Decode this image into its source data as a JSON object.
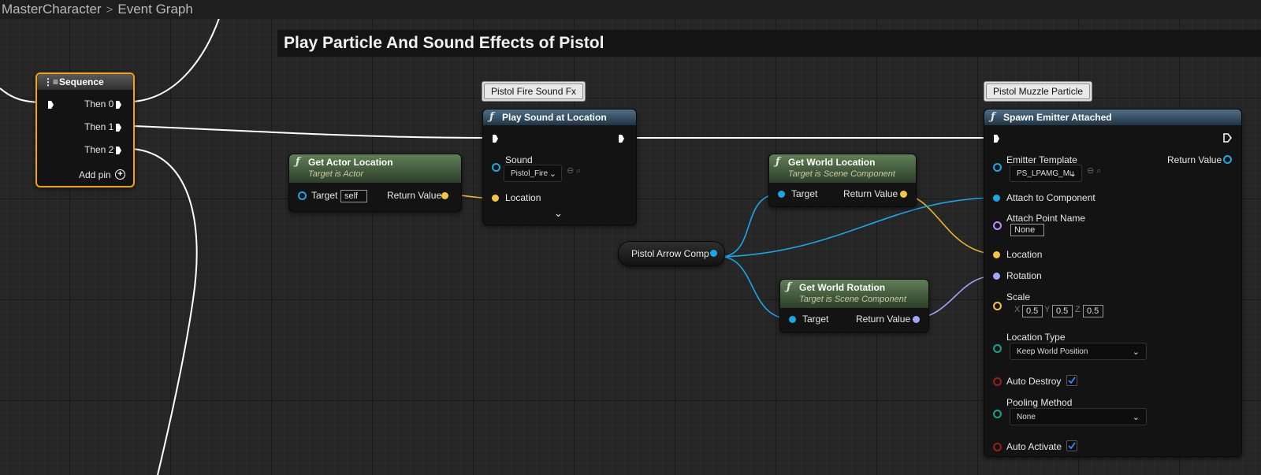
{
  "breadcrumb": {
    "parent": "MasterCharacter",
    "current": "Event Graph"
  },
  "comment": {
    "title": "Play Particle And Sound Effects of Pistol"
  },
  "tags": {
    "sound_fx": "Pistol Fire Sound Fx",
    "muzzle": "Pistol Muzzle Particle"
  },
  "sequence": {
    "title": "Sequence",
    "then0": "Then 0",
    "then1": "Then 1",
    "then2": "Then 2",
    "add_pin": "Add pin"
  },
  "get_actor_location": {
    "title": "Get Actor Location",
    "subtitle": "Target is Actor",
    "target": "Target",
    "target_value": "self",
    "return": "Return Value"
  },
  "play_sound": {
    "title": "Play Sound at Location",
    "sound": "Sound",
    "sound_value": "Pistol_Fire",
    "location": "Location"
  },
  "get_world_location": {
    "title": "Get World Location",
    "subtitle": "Target is Scene Component",
    "target": "Target",
    "return": "Return Value"
  },
  "get_world_rotation": {
    "title": "Get World Rotation",
    "subtitle": "Target is Scene Component",
    "target": "Target",
    "return": "Return Value"
  },
  "pistol_arrow": {
    "label": "Pistol Arrow Comp"
  },
  "spawn_emitter": {
    "title": "Spawn Emitter Attached",
    "emitter_template": "Emitter Template",
    "emitter_value": "PS_LPAMG_Mu",
    "return": "Return Value",
    "attach_component": "Attach to Component",
    "attach_point": "Attach Point Name",
    "attach_point_value": "None",
    "location": "Location",
    "rotation": "Rotation",
    "scale": "Scale",
    "scale_x_label": "X",
    "scale_x": "0.5",
    "scale_y_label": "Y",
    "scale_y": "0.5",
    "scale_z_label": "Z",
    "scale_z": "0.5",
    "location_type": "Location Type",
    "location_type_value": "Keep World Position",
    "auto_destroy": "Auto Destroy",
    "pooling_method": "Pooling Method",
    "pooling_value": "None",
    "auto_activate": "Auto Activate"
  },
  "colors": {
    "exec": "#ffffff",
    "vector": "#f5c542",
    "object": "#1aa7e8",
    "rotator": "#9fa6ff",
    "name": "#c28bff",
    "teal": "#1a9e8e",
    "bool": "#9b1d1d",
    "selected": "#f5a300"
  },
  "icons": {
    "function": "function-icon",
    "sequence": "sequence-icon",
    "add": "add-pin-icon",
    "chevron": "chevron-down-icon"
  }
}
